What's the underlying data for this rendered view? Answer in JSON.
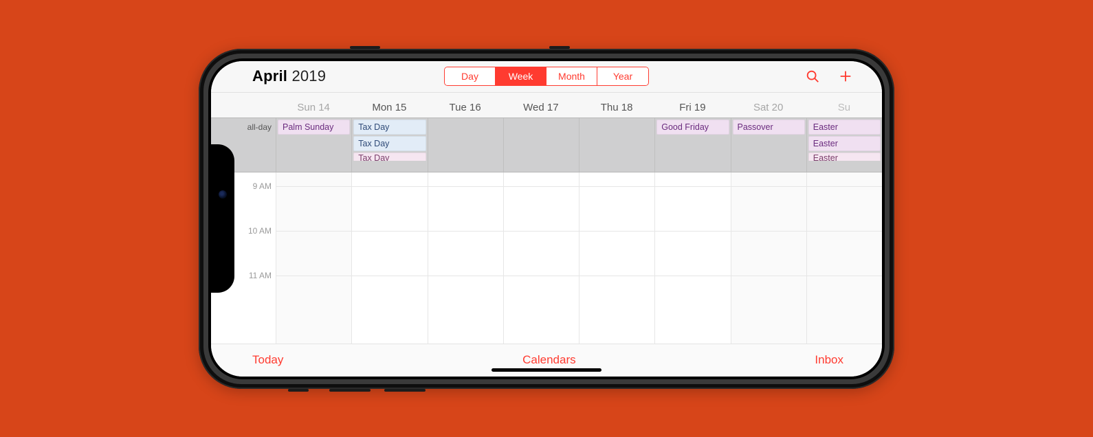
{
  "header": {
    "month": "April",
    "year": "2019"
  },
  "segments": {
    "day": "Day",
    "week": "Week",
    "month": "Month",
    "year": "Year",
    "active": "week"
  },
  "days": [
    {
      "label": "Sun 14",
      "weekend": true
    },
    {
      "label": "Mon 15",
      "weekend": false
    },
    {
      "label": "Tue 16",
      "weekend": false
    },
    {
      "label": "Wed 17",
      "weekend": false
    },
    {
      "label": "Thu 18",
      "weekend": false
    },
    {
      "label": "Fri 19",
      "weekend": false
    },
    {
      "label": "Sat 20",
      "weekend": true
    }
  ],
  "extraDay": "Su",
  "alldayLabel": "all-day",
  "alldayEvents": {
    "0": [
      {
        "text": "Palm Sunday",
        "style": "purple"
      }
    ],
    "1": [
      {
        "text": "Tax Day",
        "style": "blue"
      },
      {
        "text": "Tax Day",
        "style": "blue"
      },
      {
        "text": "Tax Day",
        "style": "pink",
        "cutoff": true
      }
    ],
    "2": [],
    "3": [],
    "4": [],
    "5": [
      {
        "text": "Good Friday",
        "style": "purple"
      }
    ],
    "6": [
      {
        "text": "Passover",
        "style": "purple"
      }
    ],
    "7": [
      {
        "text": "Easter",
        "style": "purple"
      },
      {
        "text": "Easter",
        "style": "purple"
      },
      {
        "text": "Easter",
        "style": "pink",
        "cutoff": true
      }
    ]
  },
  "hours": [
    "9 AM",
    "10 AM",
    "11 AM"
  ],
  "toolbar": {
    "today": "Today",
    "calendars": "Calendars",
    "inbox": "Inbox"
  }
}
